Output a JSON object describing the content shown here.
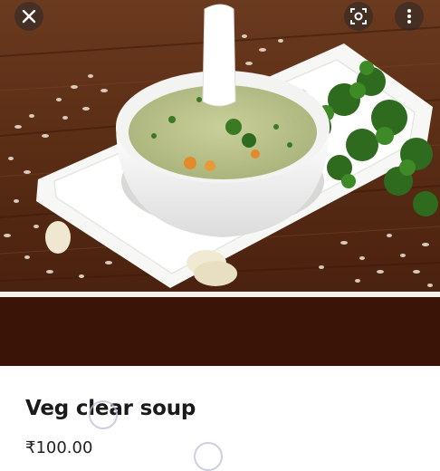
{
  "photo": {
    "alt": "Veg clear soup"
  },
  "controls": {
    "close_icon": "close-icon",
    "lens_icon": "lens-icon",
    "more_icon": "more-vert-icon"
  },
  "item": {
    "name": "Veg clear soup",
    "price": "₹100.00"
  },
  "colors": {
    "band": "#3a1406",
    "wood": "#5a2e16",
    "text": "#1a1a1a"
  }
}
